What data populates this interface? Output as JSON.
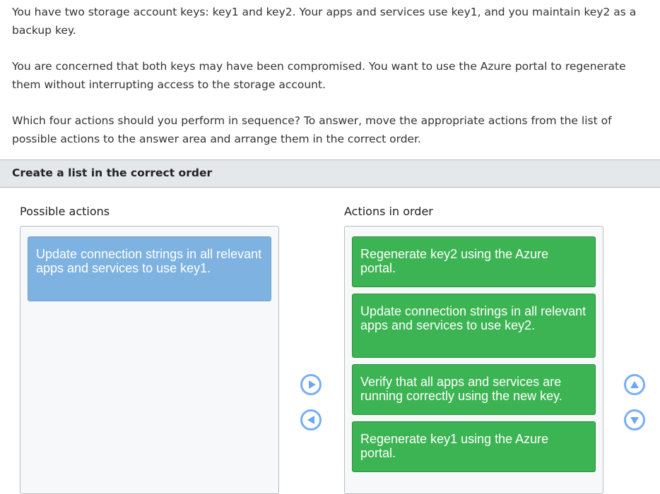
{
  "question": {
    "paragraphs": [
      "You have two storage account keys: key1 and key2. Your apps and services use key1, and you maintain key2 as a backup key.",
      "You are concerned that both keys may have been compromised. You want to use the Azure portal to regenerate them without interrupting access to the storage account.",
      "Which four actions should you perform in sequence? To answer, move the appropriate actions from the list of possible actions to the answer area and arrange them in the correct order."
    ]
  },
  "banner": {
    "title": "Create a list in the correct order"
  },
  "possible_actions": {
    "title": "Possible actions",
    "items": [
      {
        "label": "Update connection strings in all relevant apps and services to use key1.",
        "state": "selected"
      }
    ]
  },
  "actions_in_order": {
    "title": "Actions in order",
    "items": [
      {
        "label": "Regenerate key2 using the Azure portal."
      },
      {
        "label": "Update connection strings in all relevant apps and services to use key2."
      },
      {
        "label": "Verify that all apps and services are running correctly using the new key."
      },
      {
        "label": "Regenerate key1 using the Azure portal."
      }
    ]
  },
  "controls": {
    "move_right": "move-right",
    "move_left": "move-left",
    "move_up": "move-up",
    "move_down": "move-down"
  },
  "colors": {
    "selected_card": "#7eb2e0",
    "answer_card": "#3cb453",
    "control_accent": "#78aef5",
    "banner_bg": "#e5e8eb"
  }
}
